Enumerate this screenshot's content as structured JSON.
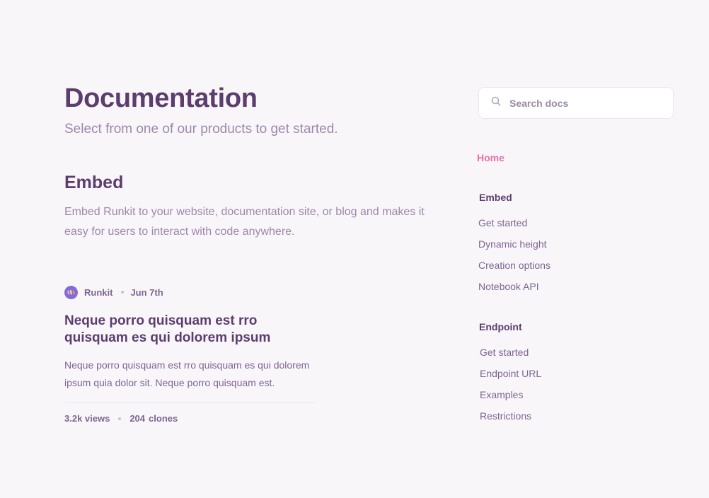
{
  "page": {
    "title": "Documentation",
    "subtitle": "Select from one of our products to get started."
  },
  "section": {
    "title": "Embed",
    "description": "Embed Runkit to your website, documentation site, or blog and makes it easy for users to interact with code anywhere."
  },
  "card": {
    "author": "Runkit",
    "date": "Jun 7th",
    "title": "Neque porro quisquam est rro quisquam es qui dolorem ipsum",
    "description": "Neque porro quisquam est rro quisquam es qui dolorem ipsum quia dolor sit. Neque porro quisquam est.",
    "views": "3.2k views",
    "clones_count": "204",
    "clones_label": "clones"
  },
  "sidebar": {
    "search_placeholder": "Search docs",
    "home_label": "Home",
    "groups": [
      {
        "title": "Embed",
        "items": [
          "Get started",
          "Dynamic height",
          "Creation options",
          "Notebook API"
        ]
      },
      {
        "title": "Endpoint",
        "items": [
          "Get started",
          "Endpoint URL",
          "Examples",
          "Restrictions"
        ]
      }
    ]
  },
  "colors": {
    "background": "#f9f6fa",
    "heading": "#5b3d6e",
    "muted": "#9c89aa",
    "body": "#7c6690",
    "accent_pink": "#ec6fa6",
    "avatar": "#7f6fd4"
  },
  "icons": {
    "search": "search-icon",
    "avatar": "runkit-logo-icon"
  }
}
